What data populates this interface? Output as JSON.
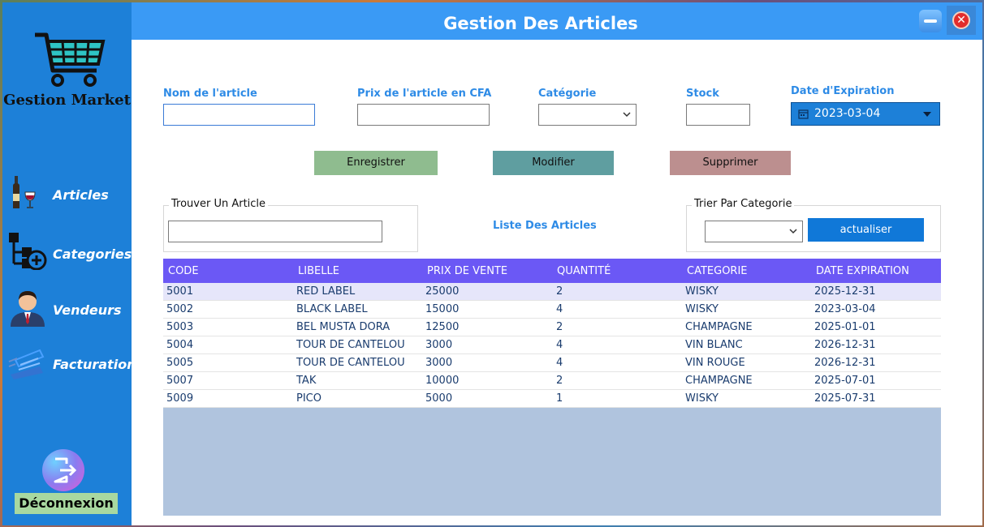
{
  "sidebar": {
    "app_name": "Gestion Market",
    "items": [
      {
        "label": "Articles",
        "icon": "wine-bottle-icon"
      },
      {
        "label": "Categories",
        "icon": "category-add-icon"
      },
      {
        "label": "Vendeurs",
        "icon": "salesperson-icon"
      },
      {
        "label": "Facturation",
        "icon": "invoice-icon"
      }
    ],
    "logout_label": "Déconnexion",
    "logout_icon": "exit-door-icon"
  },
  "header": {
    "title": "Gestion Des Articles",
    "minimize_icon": "minimize-icon",
    "close_icon": "close-icon",
    "close_glyph": "✕"
  },
  "form": {
    "name_label": "Nom de l'article",
    "name_value": "",
    "price_label": "Prix de l'article en CFA",
    "price_value": "",
    "category_label": "Catégorie",
    "category_value": "",
    "stock_label": "Stock",
    "stock_value": "",
    "expiry_label": "Date d'Expiration",
    "expiry_value": "2023-03-04"
  },
  "actions": {
    "save": "Enregistrer",
    "edit": "Modifier",
    "delete": "Supprimer"
  },
  "search": {
    "group_title": "Trouver Un Article",
    "value": ""
  },
  "list_title": "Liste Des Articles",
  "filter": {
    "group_title": "Trier Par Categorie",
    "value": "",
    "refresh": "actualiser"
  },
  "table": {
    "columns": [
      "CODE",
      "LIBELLE",
      "PRIX DE VENTE",
      "QUANTITÉ",
      "CATEGORIE",
      "DATE EXPIRATION"
    ],
    "rows": [
      [
        "5001",
        "RED LABEL",
        "25000",
        "2",
        "WISKY",
        "2025-12-31"
      ],
      [
        "5002",
        "BLACK LABEL",
        "15000",
        "4",
        "WISKY",
        "2023-03-04"
      ],
      [
        "5003",
        "BEL MUSTA DORA",
        "12500",
        "2",
        "CHAMPAGNE",
        "2025-01-01"
      ],
      [
        "5004",
        "TOUR DE CANTELOU",
        "3000",
        "4",
        "VIN BLANC",
        "2026-12-31"
      ],
      [
        "5005",
        "TOUR DE CANTELOU",
        "3000",
        "4",
        "VIN ROUGE",
        "2026-12-31"
      ],
      [
        "5007",
        "TAK",
        "10000",
        "2",
        "CHAMPAGNE",
        "2025-07-01"
      ],
      [
        "5009",
        "PICO",
        "5000",
        "1",
        "WISKY",
        "2025-07-31"
      ]
    ]
  },
  "colors": {
    "sidebar": "#1d80d8",
    "titlebar": "#3a9af5",
    "label_accent": "#2e8be6",
    "grid_header": "#6b58f5",
    "grid_empty": "#b0c4de",
    "save_btn": "#8fbc8f",
    "edit_btn": "#5f9ea0",
    "delete_btn": "#bc8f8f",
    "refresh_btn": "#1078d8"
  }
}
